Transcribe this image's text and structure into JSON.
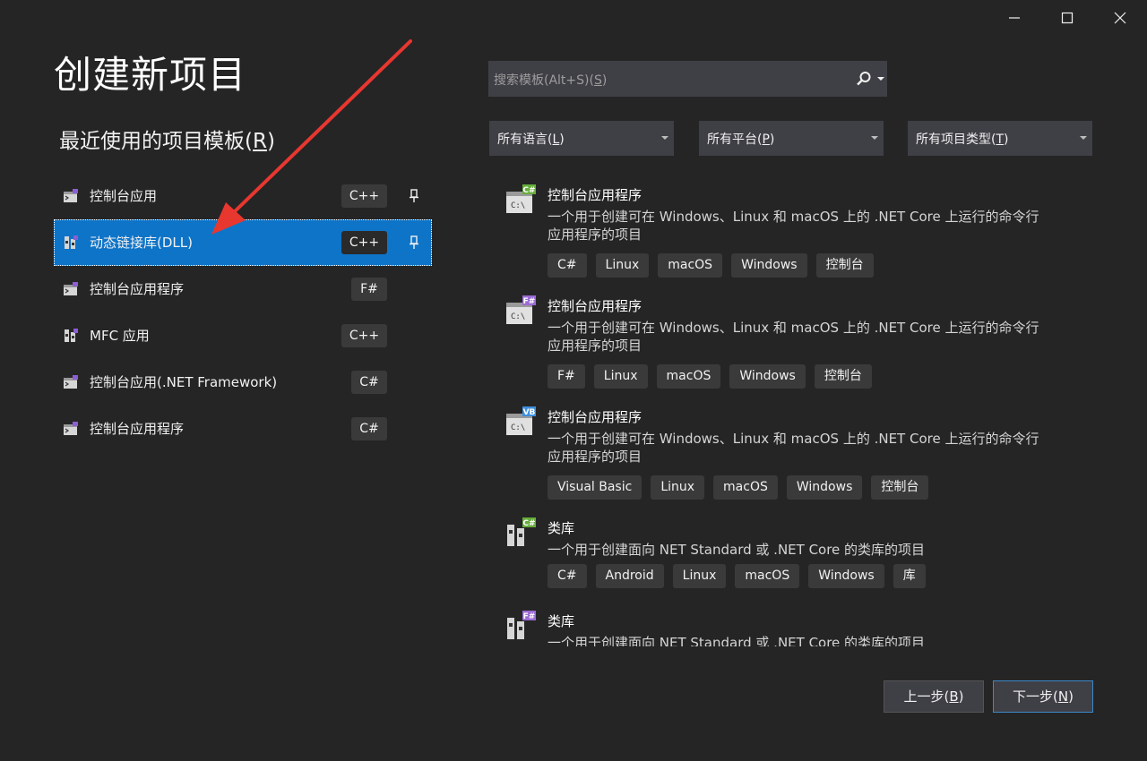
{
  "window": {
    "minimize_icon": "minimize-icon",
    "maximize_icon": "maximize-icon",
    "close_icon": "close-icon"
  },
  "title": "创建新项目",
  "recent": {
    "heading_pre": "最近使用的项目模板(",
    "heading_key": "R",
    "heading_post": ")",
    "items": [
      {
        "name": "控制台应用",
        "lang": "C++",
        "pinned": true,
        "selected": false
      },
      {
        "name": "动态链接库(DLL)",
        "lang": "C++",
        "pinned": true,
        "selected": true
      },
      {
        "name": "控制台应用程序",
        "lang": "F#",
        "pinned": false,
        "selected": false
      },
      {
        "name": "MFC 应用",
        "lang": "C++",
        "pinned": false,
        "selected": false
      },
      {
        "name": "控制台应用(.NET Framework)",
        "lang": "C#",
        "pinned": false,
        "selected": false
      },
      {
        "name": "控制台应用程序",
        "lang": "C#",
        "pinned": false,
        "selected": false
      }
    ]
  },
  "search": {
    "placeholder_pre": "搜索模板(Alt+S)(",
    "placeholder_key": "S",
    "placeholder_post": ")",
    "icon": "search-icon"
  },
  "filters": {
    "language": {
      "pre": "所有语言(",
      "key": "L",
      "post": ")"
    },
    "platform": {
      "pre": "所有平台(",
      "key": "P",
      "post": ")"
    },
    "project_type": {
      "pre": "所有项目类型(",
      "key": "T",
      "post": ")"
    }
  },
  "templates": [
    {
      "name": "控制台应用程序",
      "badge": "C#",
      "badge_color": "#67ae3c",
      "desc": "一个用于创建可在 Windows、Linux 和 macOS 上的 .NET Core 上运行的命令行应用程序的项目",
      "tags": [
        "C#",
        "Linux",
        "macOS",
        "Windows",
        "控制台"
      ]
    },
    {
      "name": "控制台应用程序",
      "badge": "F#",
      "badge_color": "#9b6bd3",
      "desc": "一个用于创建可在 Windows、Linux 和 macOS 上的 .NET Core 上运行的命令行应用程序的项目",
      "tags": [
        "F#",
        "Linux",
        "macOS",
        "Windows",
        "控制台"
      ]
    },
    {
      "name": "控制台应用程序",
      "badge": "VB",
      "badge_color": "#3d8fe0",
      "desc": "一个用于创建可在 Windows、Linux 和 macOS 上的 .NET Core 上运行的命令行应用程序的项目",
      "tags": [
        "Visual Basic",
        "Linux",
        "macOS",
        "Windows",
        "控制台"
      ]
    },
    {
      "name": "类库",
      "badge": "C#",
      "badge_color": "#67ae3c",
      "desc": "一个用于创建面向 NET Standard 或 .NET Core 的类库的项目",
      "tags": [
        "C#",
        "Android",
        "Linux",
        "macOS",
        "Windows",
        "库"
      ]
    },
    {
      "name": "类库",
      "badge": "F#",
      "badge_color": "#9b6bd3",
      "desc": "一个用于创建面向 NET Standard 或 .NET Core 的类库的项目",
      "tags": []
    }
  ],
  "buttons": {
    "back": {
      "pre": "上一步(",
      "key": "B",
      "post": ")"
    },
    "next": {
      "pre": "下一步(",
      "key": "N",
      "post": ")"
    }
  },
  "colors": {
    "background": "#252526",
    "selected": "#0e74c8",
    "annotation_arrow": "#e8372f"
  }
}
